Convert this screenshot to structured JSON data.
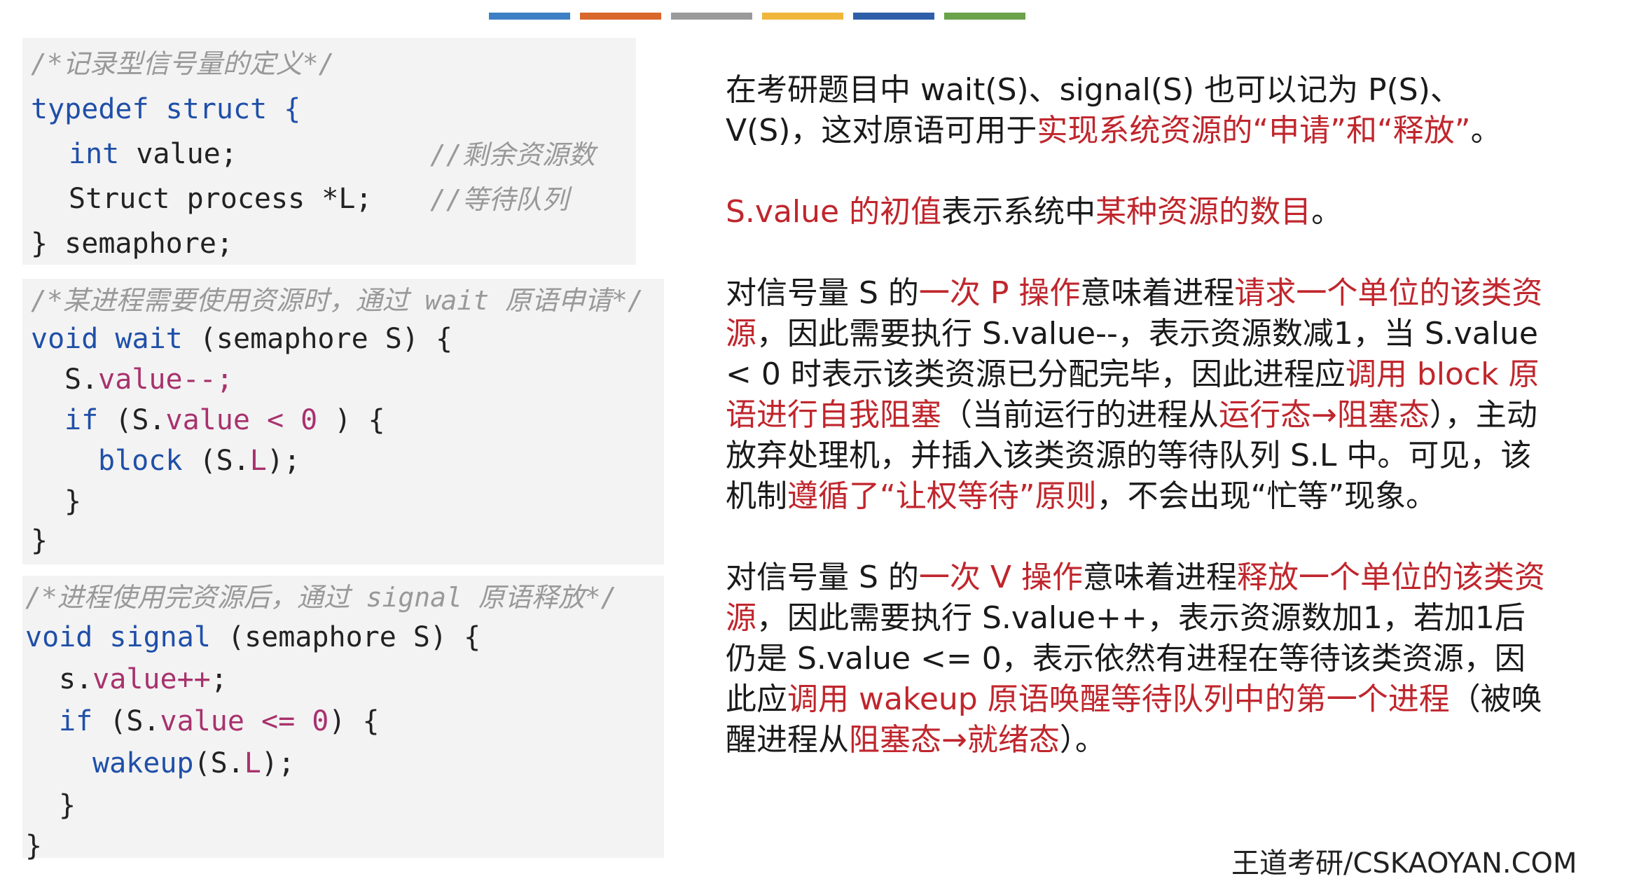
{
  "color_bars": [
    "#3d7fc4",
    "#d9672a",
    "#9a9a9a",
    "#f0b63b",
    "#2e5fa8",
    "#6aa34a"
  ],
  "code1": {
    "comment": "/*记录型信号量的定义*/",
    "line1": "typedef struct {",
    "line2_a": "int",
    "line2_b": " value;",
    "line2_c": "//剩余资源数",
    "line3_a": "Struct process *L;",
    "line3_c": "//等待队列",
    "line4": "} semaphore;"
  },
  "code2": {
    "comment": "/*某进程需要使用资源时，通过 wait 原语申请*/",
    "l1_kw": "void",
    "l1_fn": "wait",
    "l1_rest": " (semaphore S) {",
    "l2_a": "S.",
    "l2_b": "value--;",
    "l3_kw": "if",
    "l3_a": " (S.",
    "l3_b": "value < 0",
    "l3_c": " ) {",
    "l4_fn": "block",
    "l4_a": " (S.",
    "l4_b": "L",
    "l4_c": ");",
    "l5": "}",
    "l6": "}"
  },
  "code3": {
    "comment": "/*进程使用完资源后，通过 signal 原语释放*/",
    "l1_kw": "void",
    "l1_fn": "signal",
    "l1_rest": " (semaphore S) {",
    "l2_a": "s.",
    "l2_b": "value++",
    "l2_c": ";",
    "l3_kw": "if",
    "l3_a": " (S.",
    "l3_b": "value <= 0",
    "l3_c": ") {",
    "l4_fn": "wakeup",
    "l4_a": "(S.",
    "l4_b": "L",
    "l4_c": ");",
    "l5": "}",
    "l6": "}"
  },
  "paragraphs": {
    "p1": [
      {
        "t": "在考研题目中 wait(S)、signal(S) 也可以记为 P(S)、V(S)，这对原语可用于",
        "red": false
      },
      {
        "t": "实现系统资源的“申请”和“释放”",
        "red": true
      },
      {
        "t": "。",
        "red": false
      }
    ],
    "p2": [
      {
        "t": "S.value 的初值",
        "red": true
      },
      {
        "t": "表示系统中",
        "red": false
      },
      {
        "t": "某种资源的数目",
        "red": true
      },
      {
        "t": "。",
        "red": false
      }
    ],
    "p3": [
      {
        "t": "对信号量 S 的",
        "red": false
      },
      {
        "t": "一次 P 操作",
        "red": true
      },
      {
        "t": "意味着进程",
        "red": false
      },
      {
        "t": "请求一个单位的该类资源",
        "red": true
      },
      {
        "t": "，因此需要执行 S.value--，表示资源数减1，当 S.value < 0 时表示该类资源已分配完毕，因此进程应",
        "red": false
      },
      {
        "t": "调用 block 原语进行自我阻塞",
        "red": true
      },
      {
        "t": "（当前运行的进程从",
        "red": false
      },
      {
        "t": "运行态→阻塞态",
        "red": true
      },
      {
        "t": "），主动放弃处理机，并插入该类资源的等待队列 S.L 中。可见，该机制",
        "red": false
      },
      {
        "t": "遵循了“让权等待”原则",
        "red": true
      },
      {
        "t": "，不会出现“忙等”现象。",
        "red": false
      }
    ],
    "p4": [
      {
        "t": "对信号量 S 的",
        "red": false
      },
      {
        "t": "一次 V 操作",
        "red": true
      },
      {
        "t": "意味着进程",
        "red": false
      },
      {
        "t": "释放一个单位的该类资源",
        "red": true
      },
      {
        "t": "，因此需要执行 S.value++，表示资源数加1，若加1后仍是 S.value <= 0，表示依然有进程在等待该类资源，因此应",
        "red": false
      },
      {
        "t": "调用 wakeup 原语唤醒等待队列中的第一个进程",
        "red": true
      },
      {
        "t": "（被唤醒进程从",
        "red": false
      },
      {
        "t": "阻塞态→就绪态",
        "red": true
      },
      {
        "t": "）。",
        "red": false
      }
    ]
  },
  "footer": "王道考研/CSKAOYAN.COM"
}
